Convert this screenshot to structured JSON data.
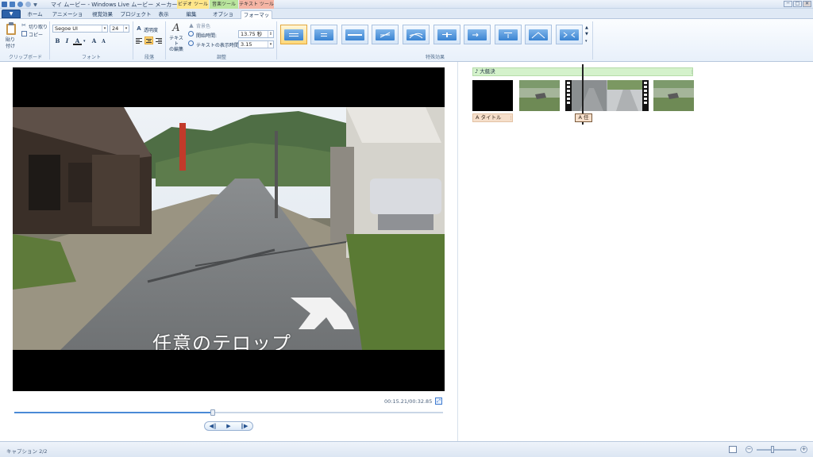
{
  "window": {
    "title": "マイ ムービー - Windows Live ムービー メーカー",
    "context_tabs": [
      {
        "label": "ビデオ ツール",
        "color": "#ffe68a"
      },
      {
        "label": "音楽ツール",
        "color": "#b9e59d"
      },
      {
        "label": "テキスト ツール",
        "color": "#f5b5a5"
      }
    ],
    "controls": {
      "minimize": "─",
      "maximize": "□",
      "close": "✕"
    }
  },
  "tabs": {
    "file": "▼",
    "items": [
      "ホーム",
      "アニメーション",
      "視覚効果",
      "プロジェクト",
      "表示",
      "編集",
      "オプション",
      "フォーマット"
    ],
    "active_index": 7
  },
  "ribbon": {
    "clipboard": {
      "paste": "貼り付け",
      "cut": "切り取り",
      "copy": "コピー",
      "label": "クリップボード"
    },
    "font": {
      "family": "Segoe UI",
      "size": "24",
      "bold": "B",
      "italic": "I",
      "color": "A",
      "grow": "A",
      "shrink": "A",
      "label": "フォント"
    },
    "paragraph": {
      "transparency": "透明度",
      "label": "段落"
    },
    "adjust": {
      "edit_text": "テキスト\nの編集",
      "background": "背景色",
      "start_time_label": "開始時間:",
      "start_time_value": "13.75 秒",
      "duration_label": "テキストの表示時間:",
      "duration_value": "3.15",
      "label": "調整"
    },
    "effects": {
      "label": "特殊効果",
      "count": 10,
      "selected_index": 0
    }
  },
  "preview": {
    "caption": "任意のテロップ",
    "timecode": "00:15.21/00:32.85",
    "progress": 0.463,
    "transport": {
      "prev": "◀‖",
      "play": "▶",
      "next": "‖▶"
    }
  },
  "storyboard": {
    "music": "♪ 大艇決",
    "title_caption": "A タイトル",
    "mini_caption": "A 任"
  },
  "status": {
    "text": "キャプション 2/2",
    "zoom": 0.4
  },
  "colors": {
    "accent": "#2c62a9",
    "selected_effect": "#ffd87a",
    "music_track": "#d4f2cb",
    "caption_track": "#f6dfcb"
  }
}
